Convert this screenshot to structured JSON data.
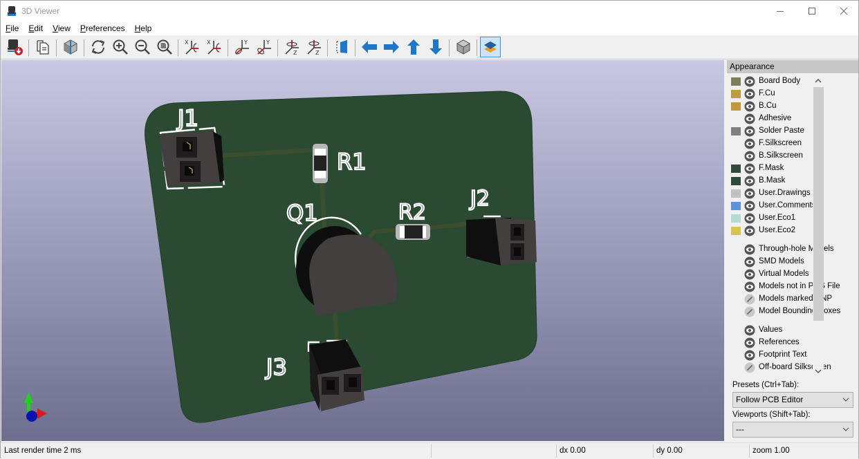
{
  "window": {
    "title": "3D Viewer",
    "controls": {
      "minimize": "—",
      "maximize": "☐",
      "close": "✕"
    }
  },
  "menu": [
    {
      "label": "File",
      "mnemonic": "F",
      "rest": "ile"
    },
    {
      "label": "Edit",
      "mnemonic": "E",
      "rest": "dit"
    },
    {
      "label": "View",
      "mnemonic": "V",
      "rest": "iew"
    },
    {
      "label": "Preferences",
      "mnemonic": "P",
      "rest": "references"
    },
    {
      "label": "Help",
      "mnemonic": "H",
      "rest": "elp"
    }
  ],
  "toolbar": {
    "buttons": [
      {
        "name": "reload-board",
        "icon": "reload-board-icon"
      },
      {
        "name": "copy-to-clipboard",
        "icon": "copy-icon"
      },
      {
        "name": "raytracing",
        "icon": "raytracing-cube-icon"
      },
      {
        "name": "refresh",
        "icon": "refresh-icon"
      },
      {
        "name": "zoom-in",
        "icon": "zoom-in-icon"
      },
      {
        "name": "zoom-out",
        "icon": "zoom-out-icon"
      },
      {
        "name": "zoom-fit",
        "icon": "zoom-fit-icon"
      },
      {
        "name": "rotate-x-cw",
        "icon": "rotate-x-clockwise-icon"
      },
      {
        "name": "rotate-x-ccw",
        "icon": "rotate-x-counterclockwise-icon"
      },
      {
        "name": "rotate-y-cw",
        "icon": "rotate-y-clockwise-icon"
      },
      {
        "name": "rotate-y-ccw",
        "icon": "rotate-y-counterclockwise-icon"
      },
      {
        "name": "rotate-z-cw",
        "icon": "rotate-z-clockwise-icon"
      },
      {
        "name": "rotate-z-ccw",
        "icon": "rotate-z-counterclockwise-icon"
      },
      {
        "name": "flip-board",
        "icon": "flip-board-icon"
      },
      {
        "name": "move-left",
        "icon": "arrow-left-icon"
      },
      {
        "name": "move-right",
        "icon": "arrow-right-icon"
      },
      {
        "name": "move-up",
        "icon": "arrow-up-icon"
      },
      {
        "name": "move-down",
        "icon": "arrow-down-icon"
      },
      {
        "name": "orthographic",
        "icon": "orthographic-cube-icon"
      },
      {
        "name": "toggle-appearance",
        "icon": "layers-icon",
        "active": true
      }
    ],
    "axis_labels": {
      "x": "X",
      "y": "Y",
      "z": "Z"
    }
  },
  "scene": {
    "references": [
      "J1",
      "R1",
      "Q1",
      "R2",
      "J2",
      "J3"
    ],
    "colors": {
      "board": "#2c4a33",
      "trace": "#3c4d2c",
      "silkscreen": "#ffffff",
      "connector_body": "#433f3f",
      "connector_side": "#0f0f0f",
      "transistor_top": "#433f3f"
    }
  },
  "appearance": {
    "title": "Appearance",
    "layers": [
      {
        "label": "Board Body",
        "color": "#7b7f5a",
        "visible": true
      },
      {
        "label": "F.Cu",
        "color": "#c19a3c",
        "visible": true
      },
      {
        "label": "B.Cu",
        "color": "#c19a3c",
        "visible": true
      },
      {
        "label": "Adhesive",
        "color": null,
        "visible": true
      },
      {
        "label": "Solder Paste",
        "color": "#808080",
        "visible": true
      },
      {
        "label": "F.Silkscreen",
        "color": null,
        "visible": true
      },
      {
        "label": "B.Silkscreen",
        "color": null,
        "visible": true
      },
      {
        "label": "F.Mask",
        "color": "#2f4a3a",
        "visible": true
      },
      {
        "label": "B.Mask",
        "color": "#2f4a3a",
        "visible": true
      },
      {
        "label": "User.Drawings",
        "color": "#c2c2c2",
        "visible": true
      },
      {
        "label": "User.Comments",
        "color": "#5b93dd",
        "visible": true
      },
      {
        "label": "User.Eco1",
        "color": "#b3ddd3",
        "visible": true
      },
      {
        "label": "User.Eco2",
        "color": "#d9c44e",
        "visible": true
      }
    ],
    "models": [
      {
        "label": "Through-hole Models",
        "visible": true
      },
      {
        "label": "SMD Models",
        "visible": true
      },
      {
        "label": "Virtual Models",
        "visible": true
      },
      {
        "label": "Models not in POS File",
        "visible": true
      },
      {
        "label": "Models marked DNP",
        "visible": false
      },
      {
        "label": "Model Bounding Boxes",
        "visible": false
      }
    ],
    "text": [
      {
        "label": "Values",
        "visible": true
      },
      {
        "label": "References",
        "visible": true
      },
      {
        "label": "Footprint Text",
        "visible": true
      },
      {
        "label": "Off-board Silkscreen",
        "visible": false
      }
    ],
    "presets_label": "Presets (Ctrl+Tab):",
    "presets_value": "Follow PCB Editor",
    "viewports_label": "Viewports (Shift+Tab):",
    "viewports_value": "---"
  },
  "status": {
    "render_time": "Last render time 2 ms",
    "dx": "dx 0.00",
    "dy": "dy 0.00",
    "zoom": "zoom 1.00"
  }
}
